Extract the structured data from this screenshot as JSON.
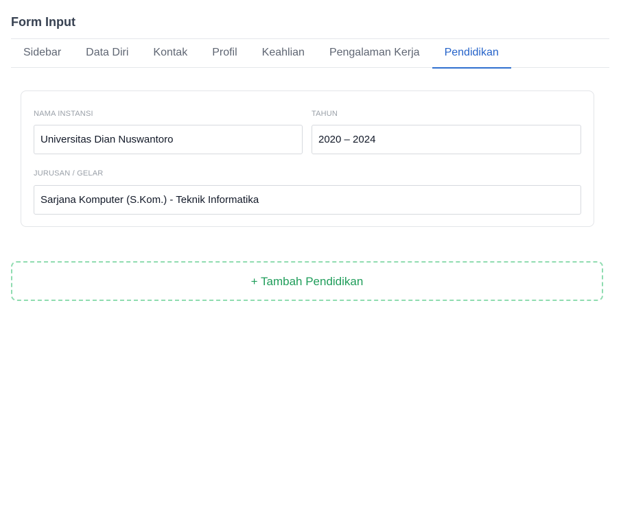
{
  "header": {
    "title": "Form Input"
  },
  "tabs": [
    {
      "label": "Sidebar",
      "active": false
    },
    {
      "label": "Data Diri",
      "active": false
    },
    {
      "label": "Kontak",
      "active": false
    },
    {
      "label": "Profil",
      "active": false
    },
    {
      "label": "Keahlian",
      "active": false
    },
    {
      "label": "Pengalaman Kerja",
      "active": false
    },
    {
      "label": "Pendidikan",
      "active": true
    }
  ],
  "education": {
    "institution": {
      "label": "NAMA INSTANSI",
      "value": "Universitas Dian Nuswantoro"
    },
    "year": {
      "label": "TAHUN",
      "value": "2020 – 2024"
    },
    "major": {
      "label": "JURUSAN / GELAR",
      "value": "Sarjana Komputer (S.Kom.) - Teknik Informatika"
    }
  },
  "actions": {
    "add_label": "+ Tambah Pendidikan"
  },
  "colors": {
    "accent": "#2563c9",
    "add_green": "#1f9d5a",
    "add_border": "#8fdcb0"
  }
}
